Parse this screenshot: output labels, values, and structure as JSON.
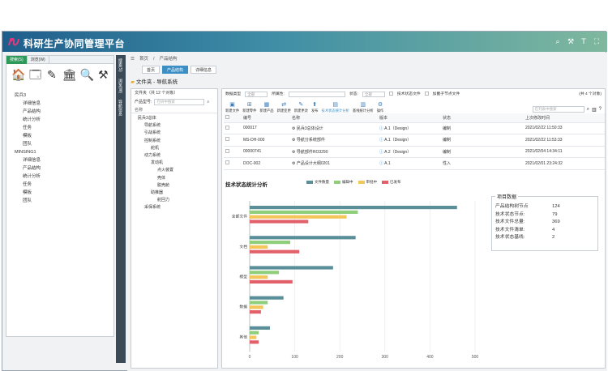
{
  "app": {
    "title": "科研生产协同管理平台"
  },
  "left_panel": {
    "tabs": [
      "搜索(S)",
      "浏览(W)"
    ],
    "tree": [
      {
        "label": "民兵3",
        "level": 0
      },
      {
        "label": "详细信息",
        "level": 1
      },
      {
        "label": "产品结构",
        "level": 1
      },
      {
        "label": "统计分析",
        "level": 1
      },
      {
        "label": "任务",
        "level": 1
      },
      {
        "label": "模板",
        "level": 1
      },
      {
        "label": "团队",
        "level": 1
      },
      {
        "label": "MINSING1",
        "level": 0
      },
      {
        "label": "详细信息",
        "level": 1
      },
      {
        "label": "产品结构",
        "level": 1
      },
      {
        "label": "统计分析",
        "level": 1
      },
      {
        "label": "任务",
        "level": 1
      },
      {
        "label": "模板",
        "level": 1
      },
      {
        "label": "团队",
        "level": 1
      }
    ]
  },
  "vstrip": {
    "tabs": [
      "搜索(S)",
      "浏览(W)",
      "导航信息"
    ]
  },
  "breadcrumb": {
    "home": "首页",
    "sep": "/",
    "current": "产品结构"
  },
  "content_tabs": [
    "首页",
    "产品结构",
    "详细信息"
  ],
  "folder_title": "文件夹 - 导航系统",
  "product_panel": {
    "header": "文件夹（共 12 个对象）",
    "search_label": "产品型号:",
    "search_placeholder": "在树中搜索",
    "column": "名称",
    "tree": [
      {
        "label": "民兵3总体",
        "indent": 0
      },
      {
        "label": "导航系统",
        "indent": 1
      },
      {
        "label": "引战系统",
        "indent": 1
      },
      {
        "label": "控制系统",
        "indent": 1
      },
      {
        "label": "舵机",
        "indent": 2
      },
      {
        "label": "动力系统",
        "indent": 1
      },
      {
        "label": "发动机",
        "indent": 2
      },
      {
        "label": "点火装置",
        "indent": 3
      },
      {
        "label": "壳体",
        "indent": 3
      },
      {
        "label": "脱壳舱",
        "indent": 3
      },
      {
        "label": "助推器",
        "indent": 2
      },
      {
        "label": "舵回力",
        "indent": 3
      },
      {
        "label": "采保系统",
        "indent": 1
      }
    ]
  },
  "filters": {
    "type_label": "数据类型",
    "type_value": "全部",
    "owner_label": "所属性:",
    "owner_value": "",
    "state_label": "状态:",
    "state_value": "全部",
    "tech_state": "技术状态文件",
    "sub_node": "加載子节点文件",
    "count": "(共 4 个对象)"
  },
  "toolbar": {
    "buttons": [
      "新建文件",
      "新建零件",
      "新建产品",
      "新建变更",
      "新建更改",
      "发布",
      "技术状态统计分析",
      "基线统计分析",
      "操作"
    ],
    "highlight_index": 6,
    "search_placeholder": "在列表中搜索"
  },
  "table": {
    "columns": [
      "",
      "编号",
      "名称",
      "版本",
      "状态",
      "上次修改时间"
    ],
    "rows": [
      {
        "id": "000017",
        "name": "民兵3总体设计",
        "version": "A.1（Design）",
        "state": "编制",
        "time": "2021/02/22 11:50:33"
      },
      {
        "id": "MS-DH-000",
        "name": "导航分系统部件",
        "version": "A.1（Design）",
        "state": "编制",
        "time": "2021/02/22 11:53:33"
      },
      {
        "id": "00000741",
        "name": "导航部件RO3290",
        "version": "A.2（Design）",
        "state": "编制",
        "time": "2021/02/04 14:34:11"
      },
      {
        "id": "DOC-002",
        "name": "产品设计大纲0201",
        "version": "A.1",
        "state": "性入",
        "time": "2021/02/01 23:24:32"
      }
    ]
  },
  "chart_data": {
    "type": "bar",
    "orientation": "horizontal",
    "title": "技术状态统计分析",
    "categories": [
      "全部文件",
      "文档",
      "模型",
      "数据",
      "其他"
    ],
    "series": [
      {
        "name": "文件数量",
        "color": "#5a8f99",
        "values": [
          460,
          235,
          185,
          75,
          45
        ]
      },
      {
        "name": "编辑中",
        "color": "#8fce7a",
        "values": [
          240,
          90,
          65,
          40,
          20
        ]
      },
      {
        "name": "审批中",
        "color": "#f4c65a",
        "values": [
          215,
          40,
          40,
          30,
          15
        ]
      },
      {
        "name": "已发布",
        "color": "#e1606a",
        "values": [
          130,
          110,
          95,
          25,
          20
        ]
      }
    ],
    "xlim": [
      0,
      500
    ],
    "xticks": [
      0,
      100,
      200,
      300,
      400,
      500
    ]
  },
  "summary": {
    "title": "项目数据",
    "rows": [
      {
        "k": "产品结构树节点",
        "v": "124"
      },
      {
        "k": "技术状态节点:",
        "v": "79"
      },
      {
        "k": "技术文件总量:",
        "v": "369"
      },
      {
        "k": "技术文件清单:",
        "v": "4"
      },
      {
        "k": "技术状态基线:",
        "v": "2"
      }
    ]
  }
}
